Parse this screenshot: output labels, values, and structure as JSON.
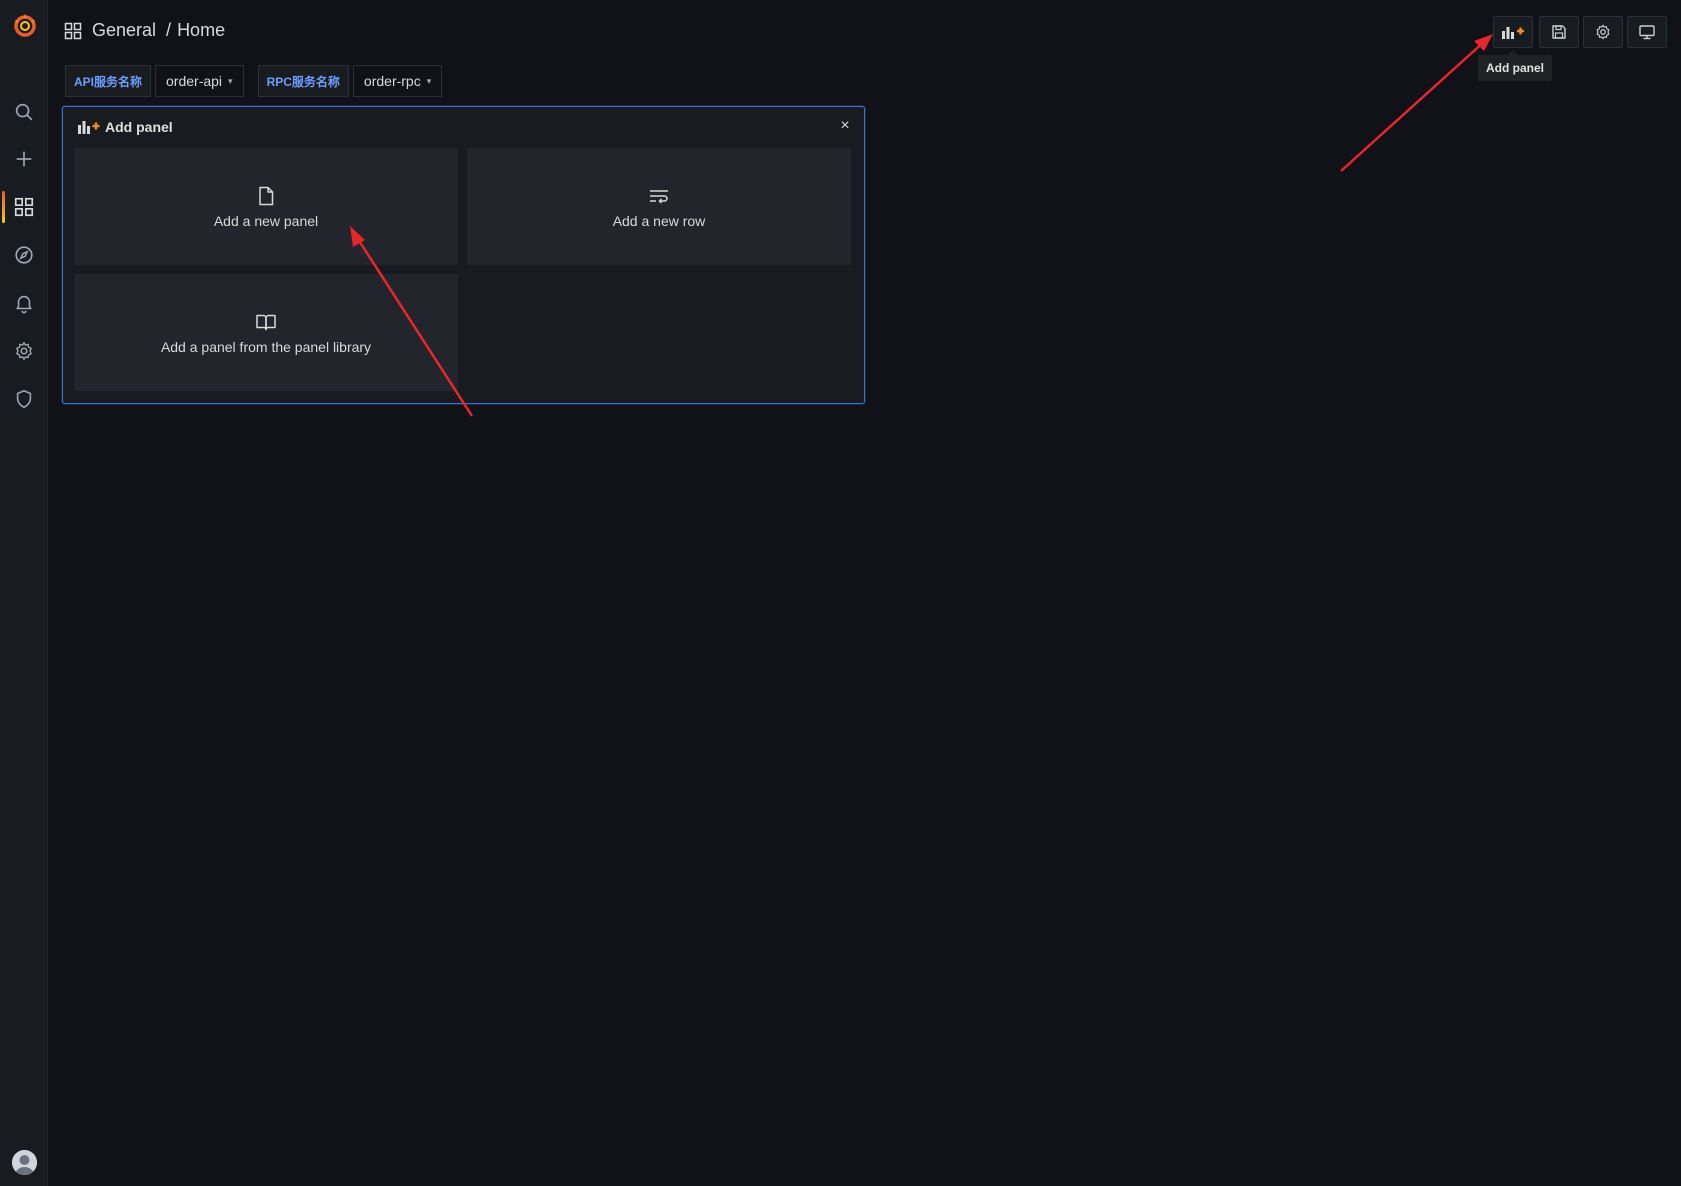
{
  "breadcrumb": {
    "folder": "General",
    "separator": "/",
    "dashboard": "Home"
  },
  "variables": [
    {
      "label": "API服务名称",
      "value": "order-api"
    },
    {
      "label": "RPC服务名称",
      "value": "order-rpc"
    }
  ],
  "toolbar": {
    "add_panel_tooltip": "Add panel",
    "buttons": [
      "add-panel-icon",
      "save-icon",
      "gear-icon",
      "monitor-icon"
    ]
  },
  "add_panel": {
    "title": "Add panel",
    "close_label": "×",
    "options": {
      "new_panel": "Add a new panel",
      "new_row": "Add a new row",
      "library": "Add a panel from the panel library"
    }
  },
  "sidebar": {
    "items": [
      "search-icon",
      "plus-icon",
      "dashboards-icon",
      "explore-icon",
      "bell-icon",
      "gear-icon",
      "shield-icon"
    ],
    "active": "dashboards-icon"
  },
  "colors": {
    "background": "#111217",
    "panel": "#181b1f",
    "card": "#22252b",
    "accent_blue": "#3d71d9",
    "variable_label": "#6e9fff",
    "annotation_arrow": "#e8262b",
    "logo_orange": "#f05a28"
  }
}
